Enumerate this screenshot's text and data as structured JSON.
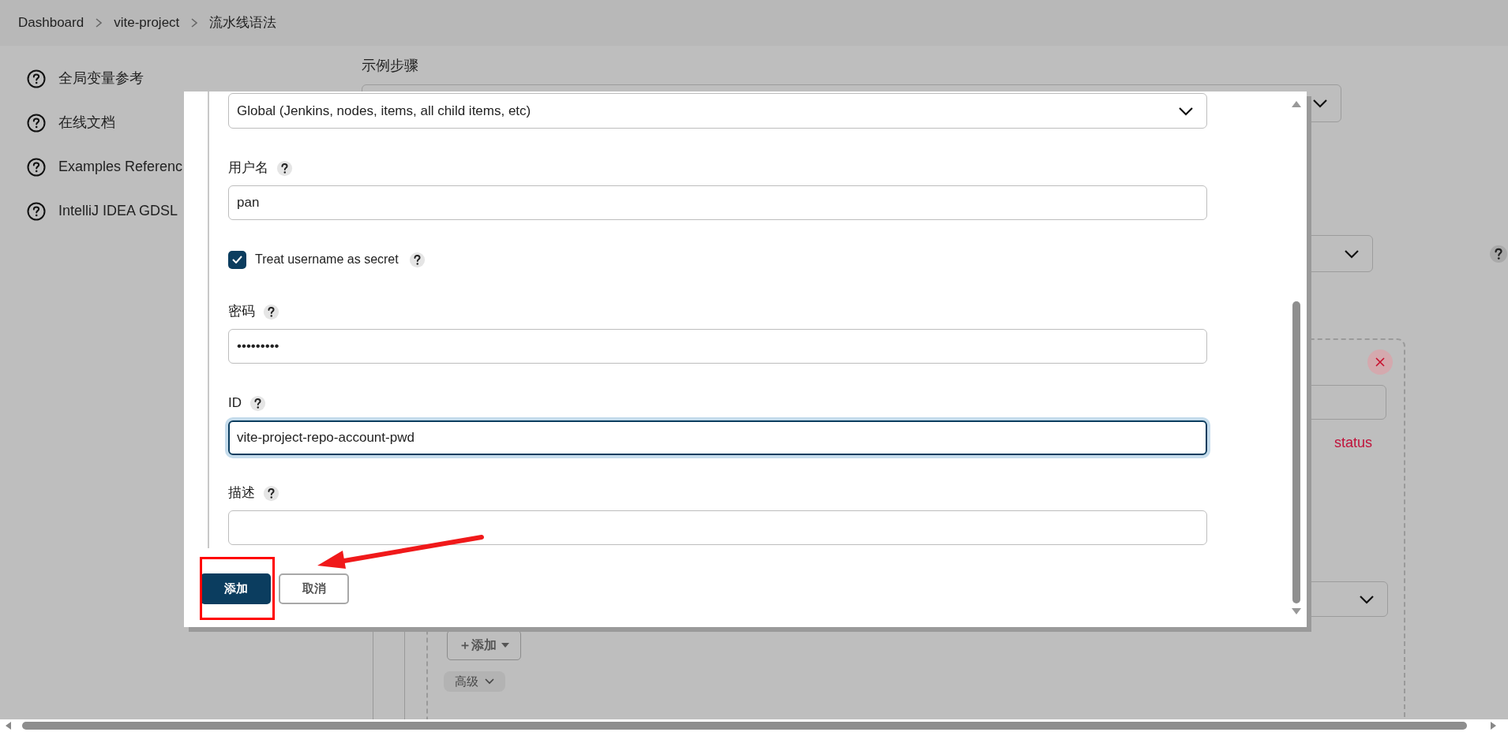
{
  "breadcrumbs": [
    {
      "label": "Dashboard"
    },
    {
      "label": "vite-project"
    },
    {
      "label": "流水线语法"
    }
  ],
  "sidebar": {
    "items": [
      {
        "label": "全局变量参考"
      },
      {
        "label": "在线文档"
      },
      {
        "label": "Examples Referenc"
      },
      {
        "label": "IntelliJ IDEA GDSL"
      }
    ]
  },
  "background_form": {
    "section_label": "示例步骤",
    "status_text": "status",
    "add_button": "＋添加",
    "advanced_button": "高级"
  },
  "dialog": {
    "scope_select": "Global (Jenkins, nodes, items, all child items, etc)",
    "fields": [
      {
        "kind": "text",
        "label": "用户名",
        "value": "pan",
        "focused": false
      },
      {
        "kind": "checkbox",
        "label": "Treat username as secret",
        "checked": true
      },
      {
        "kind": "text",
        "label": "密码",
        "value": "•••••••••",
        "focused": false
      },
      {
        "kind": "text",
        "label": "ID",
        "value": "vite-project-repo-account-pwd",
        "focused": true
      },
      {
        "kind": "text",
        "label": "描述",
        "focused": false
      }
    ],
    "buttons": [
      {
        "label": "添加",
        "kind": "primary"
      },
      {
        "label": "取消",
        "kind": "secondary"
      }
    ]
  }
}
